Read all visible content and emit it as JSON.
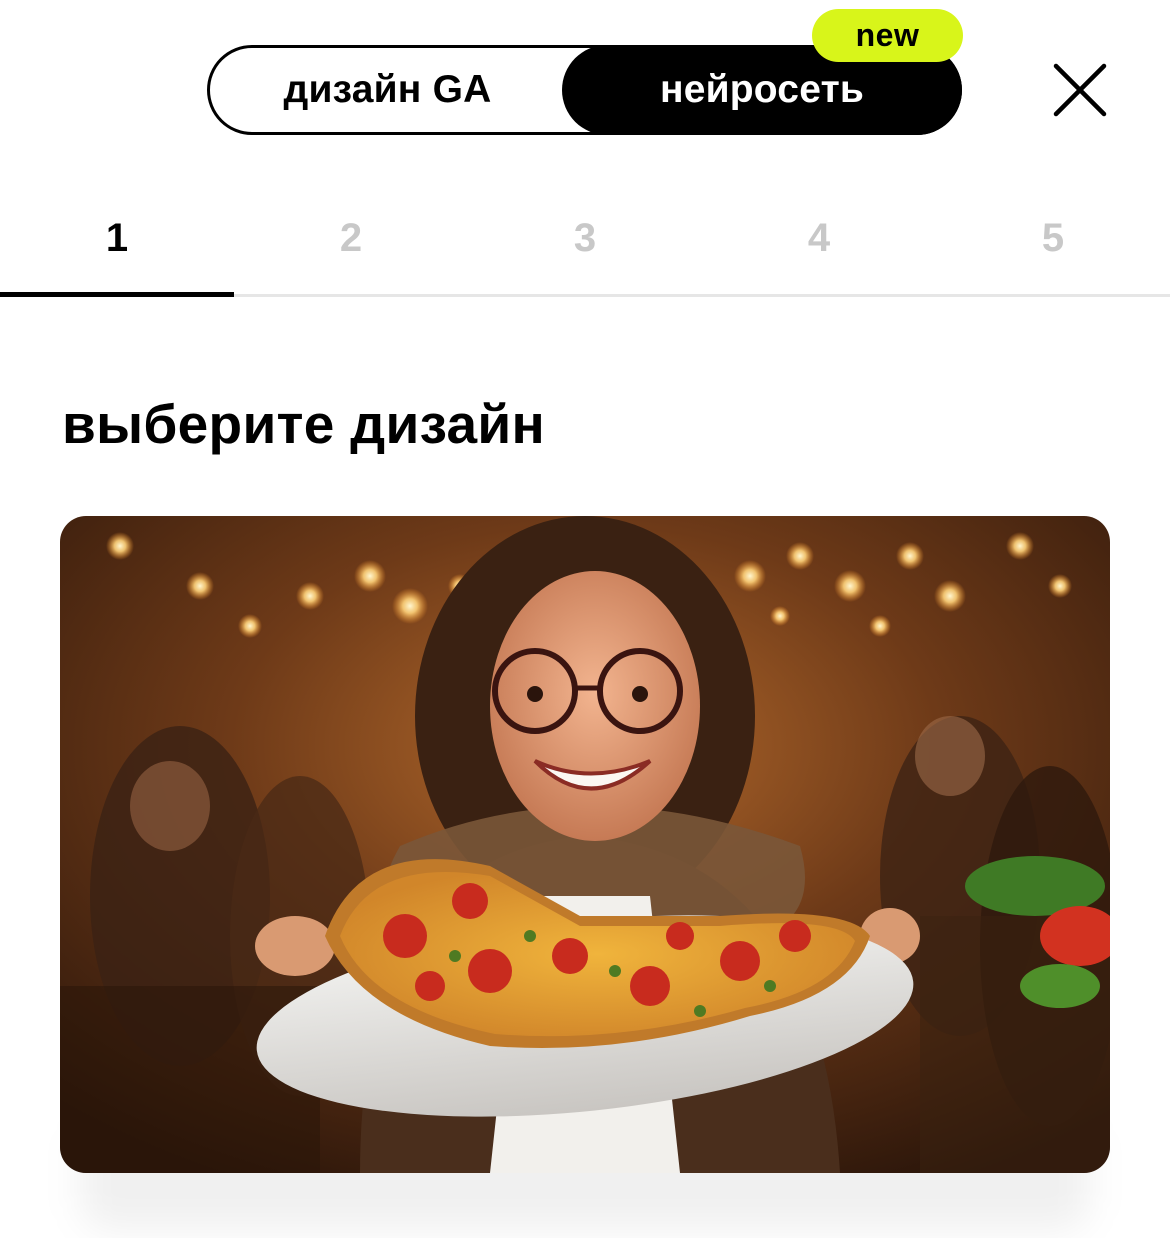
{
  "header": {
    "toggle": {
      "left_label": "дизайн GA",
      "right_label": "нейросеть",
      "badge": "new",
      "badge_color": "#d8f51a",
      "active": "right"
    },
    "close_icon": "close-icon"
  },
  "steps": {
    "items": [
      "1",
      "2",
      "3",
      "4",
      "5"
    ],
    "active": 1
  },
  "main": {
    "heading": "выберите дизайн",
    "design_card": {
      "image": "photo-girl-holding-pizza-in-cafe"
    }
  }
}
